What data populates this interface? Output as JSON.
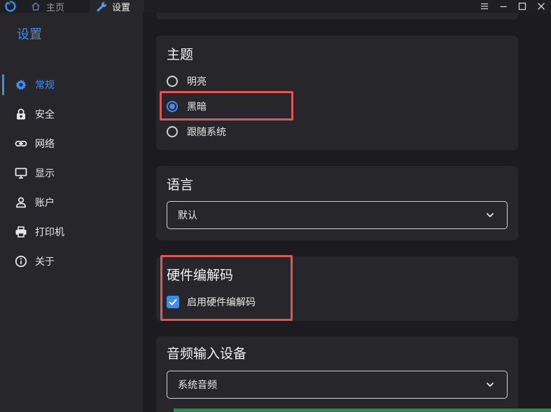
{
  "titlebar": {
    "tabs": [
      {
        "label": "主页",
        "icon": "home-icon"
      },
      {
        "label": "设置",
        "icon": "wrench-icon"
      }
    ],
    "window_controls": [
      "menu-icon",
      "minimize-icon",
      "maximize-icon",
      "close-icon"
    ]
  },
  "sidebar": {
    "title": "设置",
    "items": [
      {
        "label": "常规",
        "icon": "gear-icon",
        "active": true
      },
      {
        "label": "安全",
        "icon": "lock-icon"
      },
      {
        "label": "网络",
        "icon": "link-icon"
      },
      {
        "label": "显示",
        "icon": "monitor-icon"
      },
      {
        "label": "账户",
        "icon": "user-icon"
      },
      {
        "label": "打印机",
        "icon": "printer-icon"
      },
      {
        "label": "关于",
        "icon": "info-icon"
      }
    ]
  },
  "theme": {
    "title": "主题",
    "options": [
      {
        "label": "明亮",
        "selected": false
      },
      {
        "label": "黑暗",
        "selected": true
      },
      {
        "label": "跟随系统",
        "selected": false
      }
    ]
  },
  "language": {
    "title": "语言",
    "selected": "默认"
  },
  "hw_codec": {
    "title": "硬件编解码",
    "checkbox_label": "启用硬件编解码",
    "checked": true
  },
  "audio_input": {
    "title": "音频输入设备",
    "selected": "系统音频"
  },
  "colors": {
    "accent": "#3d8cf0",
    "highlight": "#e05555",
    "background": "#1c1c20",
    "card": "#27272b"
  }
}
